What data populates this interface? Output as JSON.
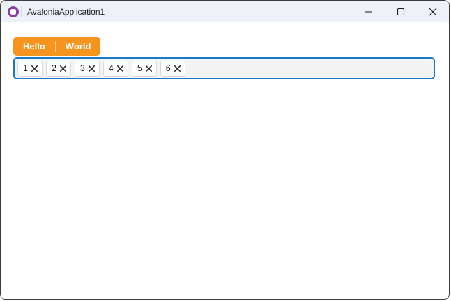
{
  "window": {
    "title": "AvaloniaApplication1"
  },
  "titlebar": {
    "icons": {
      "app": "avalonia-logo",
      "minimize": "minimize-dash",
      "maximize": "maximize-square",
      "close": "close-cross"
    }
  },
  "tab_strip": {
    "tabs": [
      {
        "label": "Hello"
      },
      {
        "label": "World"
      }
    ],
    "selected_color": "#F7941D"
  },
  "tags_box": {
    "tags": [
      {
        "label": "1"
      },
      {
        "label": "2"
      },
      {
        "label": "3"
      },
      {
        "label": "4"
      },
      {
        "label": "5"
      },
      {
        "label": "6"
      }
    ],
    "remove_icon": "close-cross",
    "focus_border_color": "#1C79C8",
    "background_color": "#F4F4F4"
  },
  "colors": {
    "titlebar_bg": "#EEF2F8",
    "window_border": "#3D3D3D",
    "avalonia_purple": "#8B40A5",
    "accent_orange": "#F7941D",
    "chip_border": "#D9D9D9",
    "text": "#1B1B1B"
  }
}
